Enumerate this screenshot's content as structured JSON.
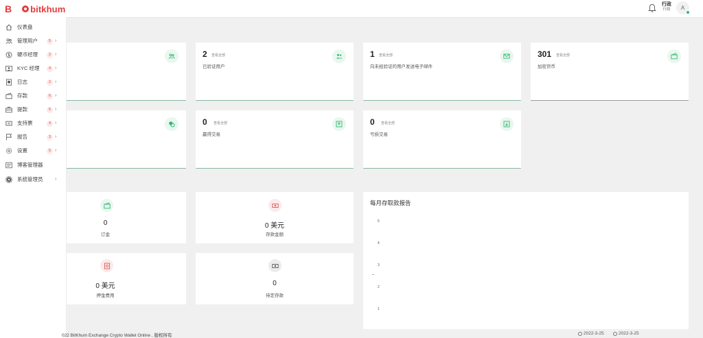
{
  "header": {
    "logo_letter": "B",
    "logo_text": "bitkhum",
    "user_name": "行政",
    "user_role": "行政",
    "avatar_letter": "A"
  },
  "sidebar": {
    "items": [
      {
        "label": "仪表盘",
        "icon": "home-icon",
        "badge": "",
        "chevron": ""
      },
      {
        "label": "管理用户",
        "icon": "users-icon",
        "badge": "5",
        "chevron": "›"
      },
      {
        "label": "硬币经理",
        "icon": "coin-icon",
        "badge": "2",
        "chevron": "›"
      },
      {
        "label": "KYC 经理",
        "icon": "id-card-icon",
        "badge": "4",
        "chevron": "›"
      },
      {
        "label": "日志",
        "icon": "log-icon",
        "badge": "2",
        "chevron": "›"
      },
      {
        "label": "存款",
        "icon": "wallet-icon",
        "badge": "6",
        "chevron": "›"
      },
      {
        "label": "提款",
        "icon": "briefcase-icon",
        "badge": "5",
        "chevron": "›"
      },
      {
        "label": "支持票",
        "icon": "ticket-icon",
        "badge": "4",
        "chevron": "›"
      },
      {
        "label": "报告",
        "icon": "flag-icon",
        "badge": "3",
        "chevron": "›"
      },
      {
        "label": "设置",
        "icon": "gear-icon",
        "badge": "5",
        "chevron": "›"
      },
      {
        "label": "博客管理器",
        "icon": "blog-icon",
        "badge": "",
        "chevron": ""
      },
      {
        "label": "系统管理员",
        "icon": "cog-icon",
        "badge": "",
        "chevron": "›"
      }
    ]
  },
  "stats": [
    {
      "value": "2",
      "unit": "查看全部",
      "desc": "已验证用户",
      "icon": "users-icon"
    },
    {
      "value": "1",
      "unit": "查看全部",
      "desc": "向未经验证的用户发送电子邮件",
      "icon": "mail-icon"
    },
    {
      "value": "301",
      "unit": "查看全部",
      "desc": "加密货币",
      "icon": "wallet-icon"
    },
    {
      "value": "0",
      "unit": "查看全部",
      "desc": "赢得交易",
      "icon": "arrow-up-box-icon"
    },
    {
      "value": "0",
      "unit": "查看全部",
      "desc": "亏损交易",
      "icon": "arrow-down-box-icon"
    }
  ],
  "summary": [
    {
      "value": "0",
      "desc": "订金",
      "icon": "wallet-icon",
      "color": "#2eb872"
    },
    {
      "value": "0 美元",
      "desc": "存款金额",
      "icon": "money-icon",
      "color": "#e05555"
    },
    {
      "value": "0 美元",
      "desc": "押金费用",
      "icon": "receipt-icon",
      "color": "#e05555"
    },
    {
      "value": "0",
      "desc": "待定存款",
      "icon": "cash-icon",
      "color": "#555555"
    }
  ],
  "report": {
    "title": "每月存取款报告"
  },
  "chart_data": {
    "type": "line",
    "title": "每月存取款报告",
    "y_ticks": [
      "5",
      "4",
      "3",
      "2",
      "1"
    ],
    "ylim": [
      0,
      5
    ],
    "series": []
  },
  "footer": {
    "copyright": "022  BitKhum Exchange Crypto Wallet Online , 版权所有",
    "date_start": "2022-3-25",
    "date_end": "2022-3-25"
  }
}
